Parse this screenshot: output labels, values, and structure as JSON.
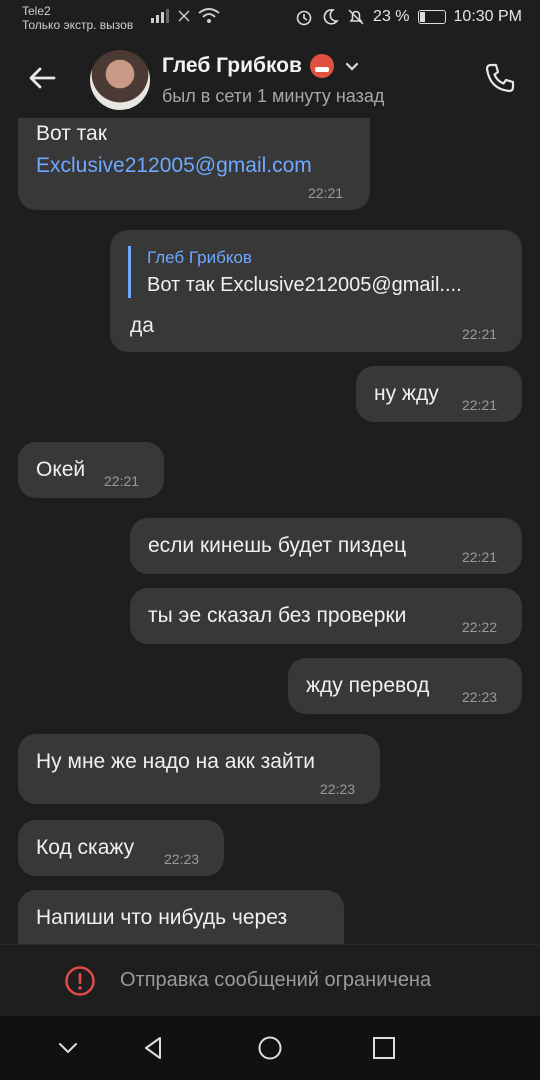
{
  "status_bar": {
    "carrier": "Tele2",
    "carrier_sub": "Только экстр. вызов",
    "battery": "23 %",
    "battery_level": 0.23,
    "time": "10:30 PM"
  },
  "header": {
    "contact_name": "Глеб Грибков",
    "last_seen": "был в сети 1 минуту назад"
  },
  "messages": [
    {
      "side": "in",
      "text": "Вот так",
      "link": "Exclusive212005@gmail.com",
      "time": "22:21"
    },
    {
      "side": "out",
      "reply_name": "Глеб Грибков",
      "reply_text": "Вот так Exclusive212005@gmail....",
      "text": "да",
      "time": "22:21"
    },
    {
      "side": "out",
      "text": "ну жду",
      "time": "22:21"
    },
    {
      "side": "in",
      "text": "Окей",
      "time": "22:21"
    },
    {
      "side": "out",
      "text": "если кинешь будет пиздец",
      "time": "22:21"
    },
    {
      "side": "out",
      "text": "ты эе сказал без проверки",
      "time": "22:22"
    },
    {
      "side": "out",
      "text": "жду перевод",
      "time": "22:23"
    },
    {
      "side": "in",
      "text": "Ну мне же надо на акк зайти",
      "time": "22:23"
    },
    {
      "side": "in",
      "text": "Код скажу",
      "time": "22:23"
    },
    {
      "side": "in",
      "text": "Напиши что нибудь через",
      "time": ""
    }
  ],
  "footer": {
    "restricted_text": "Отправка сообщений ограничена"
  },
  "colors": {
    "background": "#1e1e1e",
    "bubble": "#383838",
    "link": "#6fa8ff",
    "warning": "#e24a4a"
  }
}
